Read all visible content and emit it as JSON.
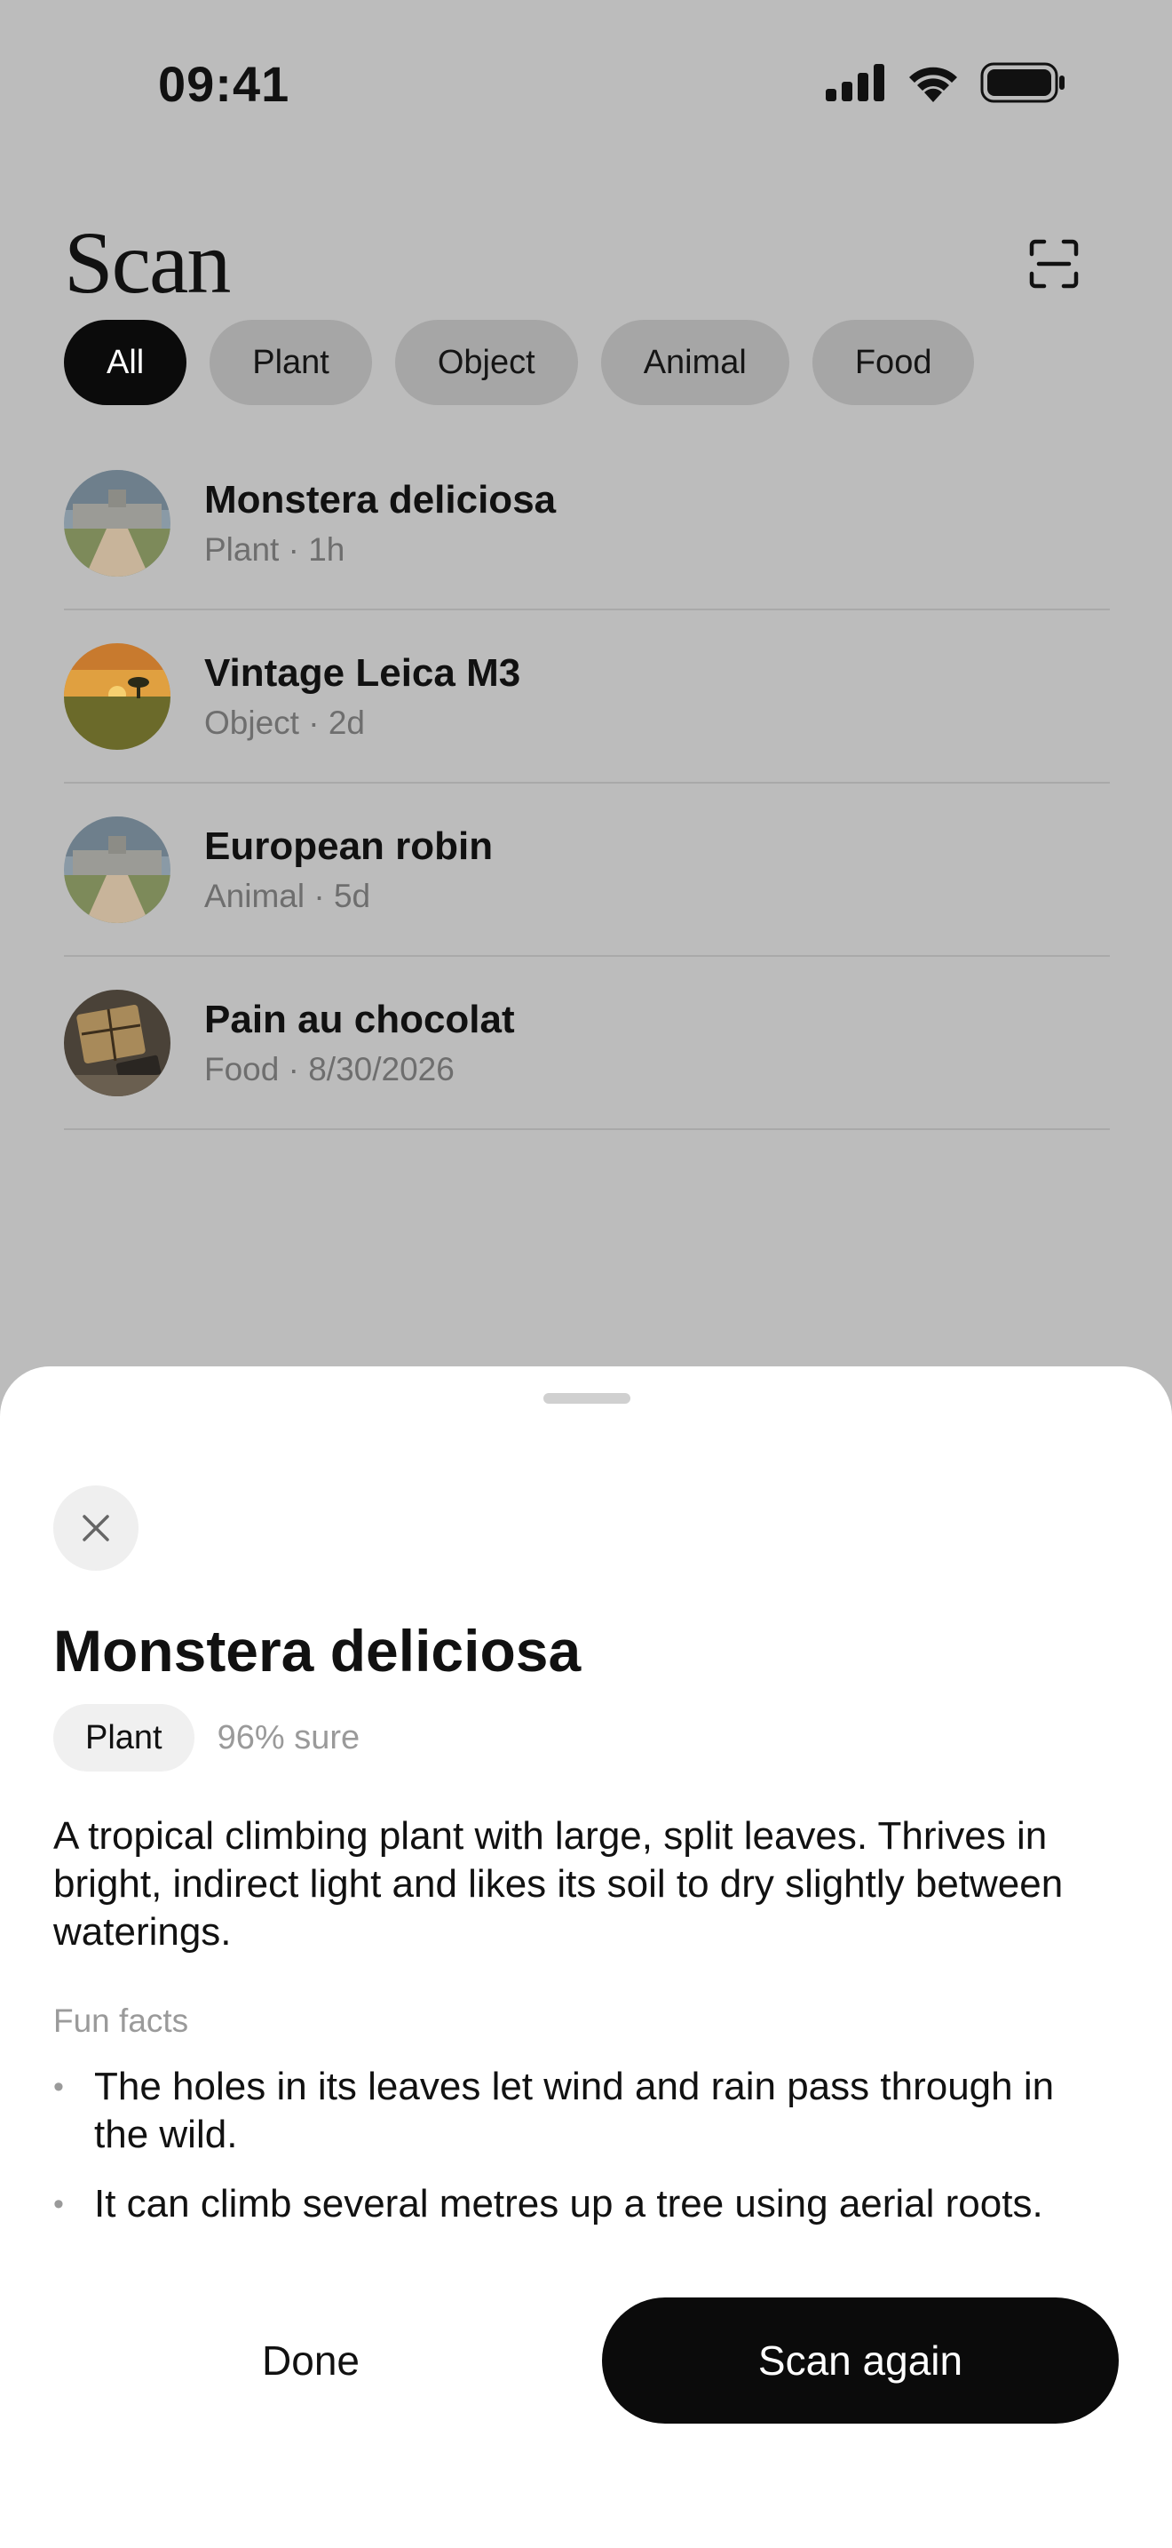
{
  "status_bar": {
    "time": "09:41",
    "icons": [
      "cellular-signal-icon",
      "wifi-icon",
      "battery-icon"
    ]
  },
  "header": {
    "title": "Scan",
    "scan_icon": "scan-frame-icon"
  },
  "filters": {
    "selected": "All",
    "chips": [
      "All",
      "Plant",
      "Object",
      "Animal",
      "Food"
    ]
  },
  "history": [
    {
      "title": "Monstera deliciosa",
      "subtitle": "Plant · 1h",
      "thumb": "chateau-photo"
    },
    {
      "title": "Vintage Leica M3",
      "subtitle": "Object · 2d",
      "thumb": "sunset-field-photo"
    },
    {
      "title": "European robin",
      "subtitle": "Animal · 5d",
      "thumb": "chateau-photo"
    },
    {
      "title": "Pain au chocolat",
      "subtitle": "Food · 8/30/2026",
      "thumb": "parcel-photo"
    }
  ],
  "sheet": {
    "close_icon": "close-icon",
    "title": "Monstera deliciosa",
    "category": "Plant",
    "confidence": "96% sure",
    "description": "A tropical climbing plant with large, split leaves. Thrives in bright, indirect light and likes its soil to dry slightly between waterings.",
    "facts_heading": "Fun facts",
    "facts": [
      "The holes in its leaves let wind and rain pass through in the wild.",
      "It can climb several metres up a tree using aerial roots."
    ],
    "done_label": "Done",
    "scan_again_label": "Scan again"
  },
  "colors": {
    "dim_background": "#bcbcbc",
    "chip_inactive": "#a6a6a6",
    "chip_active": "#0b0b0b",
    "sheet_background": "#ffffff",
    "primary_button": "#0b0b0b",
    "muted_text": "#9a9a9a"
  }
}
